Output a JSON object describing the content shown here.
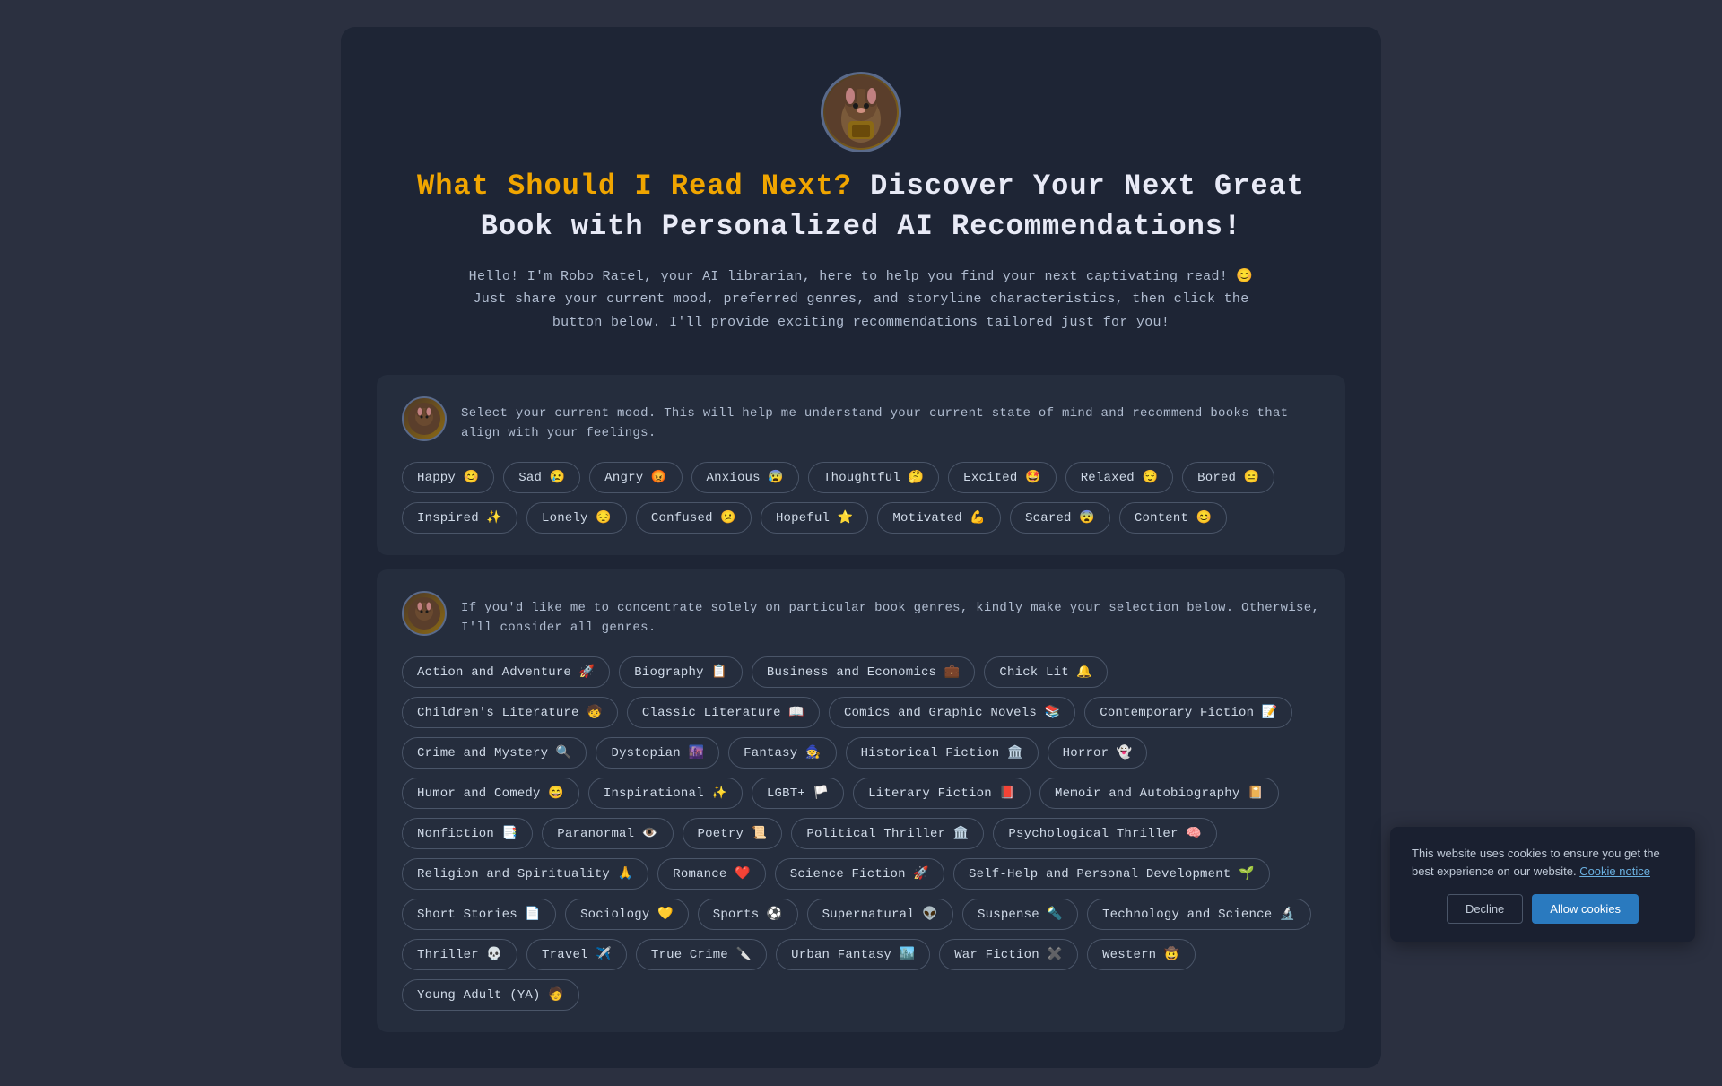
{
  "page": {
    "background_color": "#2b3040",
    "card_background": "#1e2535"
  },
  "hero": {
    "mascot_emoji": "🐀",
    "title_yellow": "What Should I Read Next?",
    "title_white": " Discover Your Next Great Book with Personalized AI Recommendations!",
    "description": "Hello! I'm Robo Ratel, your AI librarian, here to help you find your next captivating read! 😊 Just share your current mood, preferred genres, and storyline characteristics, then click the button below. I'll provide exciting recommendations tailored just for you!"
  },
  "mood_section": {
    "description": "Select your current mood. This will help me understand your current state of mind and recommend books that align with your feelings.",
    "moods": [
      {
        "label": "Happy",
        "emoji": "😊"
      },
      {
        "label": "Sad",
        "emoji": "😢"
      },
      {
        "label": "Angry",
        "emoji": "😡"
      },
      {
        "label": "Anxious",
        "emoji": "😰"
      },
      {
        "label": "Thoughtful",
        "emoji": "🤔"
      },
      {
        "label": "Excited",
        "emoji": "🤩"
      },
      {
        "label": "Relaxed",
        "emoji": "😌"
      },
      {
        "label": "Bored",
        "emoji": "😑"
      },
      {
        "label": "Inspired",
        "emoji": "✨"
      },
      {
        "label": "Lonely",
        "emoji": "😔"
      },
      {
        "label": "Confused",
        "emoji": "😕"
      },
      {
        "label": "Hopeful",
        "emoji": "⭐"
      },
      {
        "label": "Motivated",
        "emoji": "💪"
      },
      {
        "label": "Scared",
        "emoji": "😨"
      },
      {
        "label": "Content",
        "emoji": "😊"
      }
    ]
  },
  "genre_section": {
    "description": "If you'd like me to concentrate solely on particular book genres, kindly make your selection below. Otherwise, I'll consider all genres.",
    "genres": [
      {
        "label": "Action and Adventure",
        "emoji": "🚀"
      },
      {
        "label": "Biography",
        "emoji": "📋"
      },
      {
        "label": "Business and Economics",
        "emoji": "💼"
      },
      {
        "label": "Chick Lit",
        "emoji": "🔔"
      },
      {
        "label": "Children's Literature",
        "emoji": "🧒"
      },
      {
        "label": "Classic Literature",
        "emoji": "📖"
      },
      {
        "label": "Comics and Graphic Novels",
        "emoji": "📚"
      },
      {
        "label": "Contemporary Fiction",
        "emoji": "📝"
      },
      {
        "label": "Crime and Mystery",
        "emoji": "🔍"
      },
      {
        "label": "Dystopian",
        "emoji": "🌆"
      },
      {
        "label": "Fantasy",
        "emoji": "🧙"
      },
      {
        "label": "Historical Fiction",
        "emoji": "🏛️"
      },
      {
        "label": "Horror",
        "emoji": "👻"
      },
      {
        "label": "Humor and Comedy",
        "emoji": "😄"
      },
      {
        "label": "Inspirational",
        "emoji": "✨"
      },
      {
        "label": "LGBT+",
        "emoji": "🏳️"
      },
      {
        "label": "Literary Fiction",
        "emoji": "📕"
      },
      {
        "label": "Memoir and Autobiography",
        "emoji": "📔"
      },
      {
        "label": "Nonfiction",
        "emoji": "📑"
      },
      {
        "label": "Paranormal",
        "emoji": "👁️"
      },
      {
        "label": "Poetry",
        "emoji": "📜"
      },
      {
        "label": "Political Thriller",
        "emoji": "🏛️"
      },
      {
        "label": "Psychological Thriller",
        "emoji": "🧠"
      },
      {
        "label": "Religion and Spirituality",
        "emoji": "🙏"
      },
      {
        "label": "Romance",
        "emoji": "❤️"
      },
      {
        "label": "Science Fiction",
        "emoji": "🚀"
      },
      {
        "label": "Self-Help and Personal Development",
        "emoji": "🌱"
      },
      {
        "label": "Short Stories",
        "emoji": "📄"
      },
      {
        "label": "Sociology",
        "emoji": "💛"
      },
      {
        "label": "Sports",
        "emoji": "⚽"
      },
      {
        "label": "Supernatural",
        "emoji": "👽"
      },
      {
        "label": "Suspense",
        "emoji": "🔦"
      },
      {
        "label": "Technology and Science",
        "emoji": "🔬"
      },
      {
        "label": "Thriller",
        "emoji": "💀"
      },
      {
        "label": "Travel",
        "emoji": "✈️"
      },
      {
        "label": "True Crime",
        "emoji": "🔪"
      },
      {
        "label": "Urban Fantasy",
        "emoji": "🏙️"
      },
      {
        "label": "War Fiction",
        "emoji": "✖️"
      },
      {
        "label": "Western",
        "emoji": "🤠"
      },
      {
        "label": "Young Adult (YA)",
        "emoji": "🧑"
      }
    ]
  },
  "cookie_banner": {
    "text": "This website uses cookies to ensure you get the best experience on our website.",
    "link_text": "Cookie notice",
    "decline_label": "Decline",
    "allow_label": "Allow cookies"
  }
}
